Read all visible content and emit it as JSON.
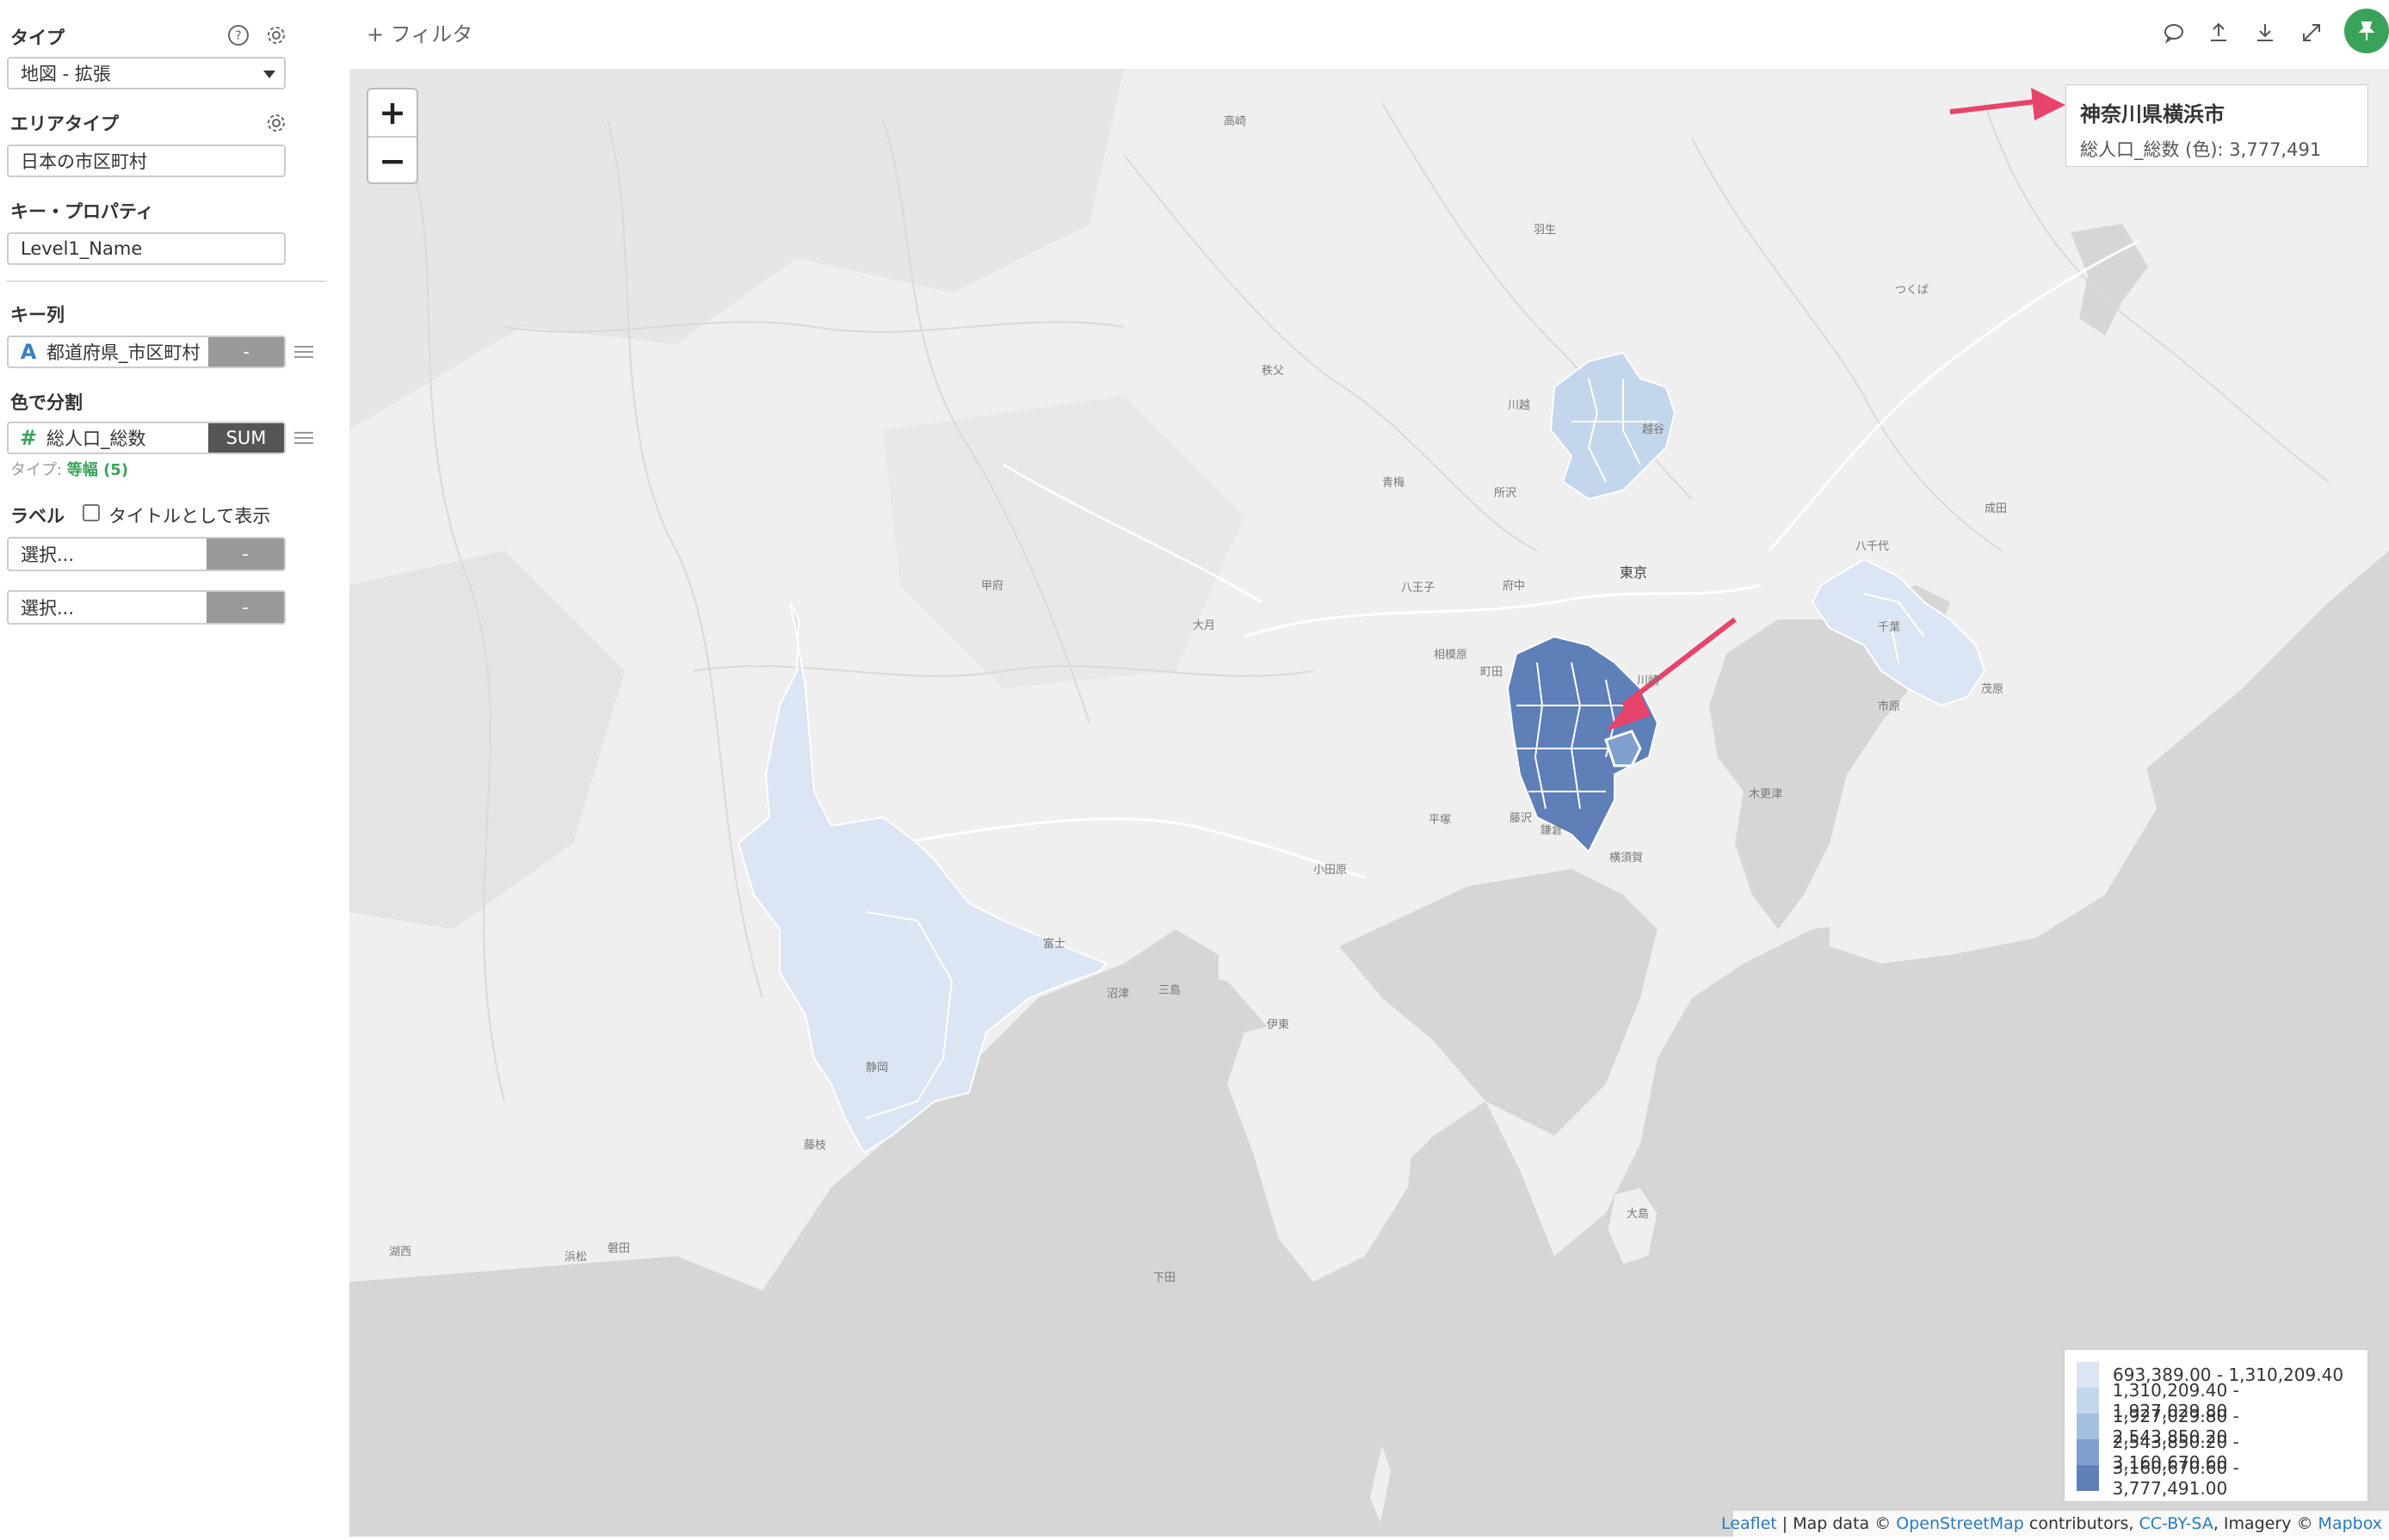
{
  "sidebar": {
    "type_label": "タイプ",
    "type_value": "地図 - 拡張",
    "area_type_label": "エリアタイプ",
    "area_type_value": "日本の市区町村",
    "key_property_label": "キー・プロパティ",
    "key_property_value": "Level1_Name",
    "key_column_label": "キー列",
    "key_column_type": "A",
    "key_column_value": "都道府県_市区町村",
    "key_column_action": "-",
    "color_label": "色で分割",
    "color_type": "#",
    "color_value": "総人口_総数",
    "color_agg": "SUM",
    "color_subtype_prefix": "タイプ: ",
    "color_subtype_value": "等幅 (5)",
    "label_label": "ラベル",
    "label_checkbox": "タイトルとして表示",
    "select1_placeholder": "選択...",
    "select1_action": "-",
    "select2_placeholder": "選択...",
    "select2_action": "-"
  },
  "topbar": {
    "filter_label": "+ フィルタ",
    "icons": [
      "comment-icon",
      "share-icon",
      "download-icon",
      "expand-icon",
      "pin-icon"
    ]
  },
  "map": {
    "zoom_in": "+",
    "zoom_out": "−",
    "tooltip": {
      "title": "神奈川県横浜市",
      "value": "総人口_総数 (色): 3,777,491"
    },
    "legend": [
      {
        "label": "693,389.00 - 1,310,209.40",
        "color": "#dbe5f3"
      },
      {
        "label": "1,310,209.40 - 1,927,029.80",
        "color": "#c3d6ec"
      },
      {
        "label": "1,927,029.80 - 2,543,850.20",
        "color": "#a4bfe0"
      },
      {
        "label": "2,543,850.20 - 3,160,670.60",
        "color": "#7f9fce"
      },
      {
        "label": "3,160,670.60 - 3,777,491.00",
        "color": "#5e7fb8"
      }
    ],
    "attribution": {
      "leaflet": "Leaflet",
      "sep1": " | Map data © ",
      "osm": "OpenStreetMap",
      "sep2": " contributors, ",
      "license": "CC-BY-SA",
      "sep3": ", Imagery © ",
      "mapbox": "Mapbox"
    },
    "places": {
      "tokyo": "東京",
      "kawasaki": "川崎",
      "yokosuka": "横須賀",
      "kamakura": "鎌倉",
      "fujisawa": "藤沢",
      "hiratsuka": "平塚",
      "odawara": "小田原",
      "sagamihara": "相模原",
      "machida": "町田",
      "hachioji": "八王子",
      "fuchu": "府中",
      "tokorozawa": "所沢",
      "kawagoe": "川越",
      "koshigaya": "越谷",
      "chiba": "千葉",
      "ichihara": "市原",
      "kisarazu": "木更津",
      "mobara": "茂原",
      "yachiyo": "八千代",
      "narita": "成田",
      "tsukuba": "つくば",
      "kofu": "甲府",
      "fuji": "富士",
      "shizuoka": "静岡",
      "hamamatsu": "浜松",
      "iwata": "磐田",
      "fujieda": "藤枝",
      "ito": "伊東",
      "mishima": "三島",
      "numazu": "沼津",
      "otsuki": "大月",
      "hanyu": "羽生",
      "takasaki": "高崎",
      "chichibu": "秩父",
      "ome": "青梅",
      "kohama": "湖西",
      "shimoda": "下田",
      "oshima": "大島"
    }
  }
}
